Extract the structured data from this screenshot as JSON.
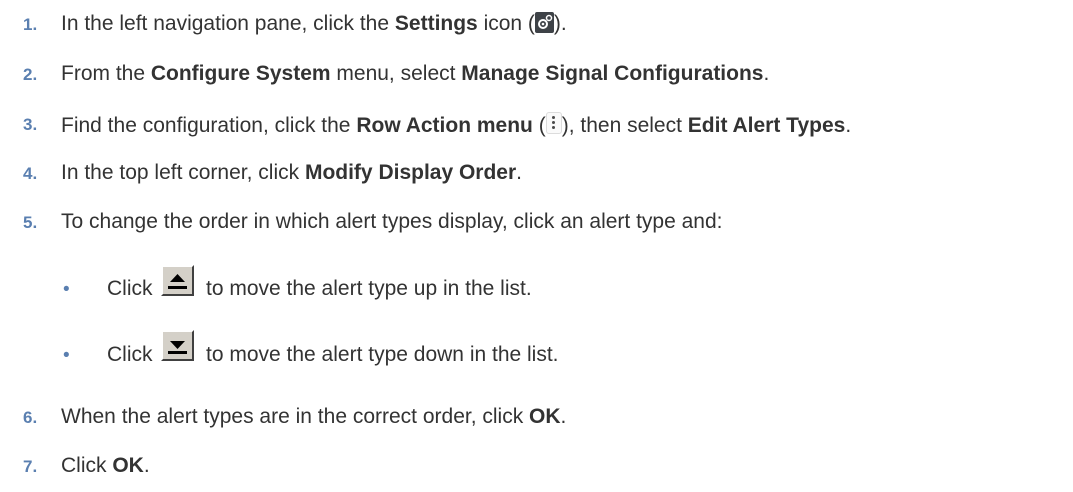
{
  "steps": [
    {
      "num": "1.",
      "pre": "In the left navigation pane, click the ",
      "b1": "Settings",
      "post": " icon (",
      "end": ")."
    },
    {
      "num": "2.",
      "pre": "From the ",
      "b1": "Configure System",
      "mid": " menu, select ",
      "b2": "Manage Signal Configurations",
      "end": "."
    },
    {
      "num": "3.",
      "pre": "Find the configuration, click the ",
      "b1": "Row Action menu",
      "mid": " (",
      "mid2": "), then select ",
      "b2": "Edit Alert Types",
      "end": "."
    },
    {
      "num": "4.",
      "pre": "In the top left corner, click ",
      "b1": "Modify Display Order",
      "end": "."
    },
    {
      "num": "5.",
      "pre": "To change the order in which alert types display, click an alert type and:"
    },
    {
      "num": "6.",
      "pre": "When the alert types are in the correct order, click ",
      "b1": "OK",
      "end": "."
    },
    {
      "num": "7.",
      "pre": "Click ",
      "b1": "OK",
      "end": "."
    }
  ],
  "substeps": [
    {
      "bullet": "•",
      "pre": "Click",
      "post": "to move the alert type up in the list.",
      "icon": "move-up-arrow-icon"
    },
    {
      "bullet": "•",
      "pre": "Click",
      "post": "to move the alert type down in the list.",
      "icon": "move-down-arrow-icon"
    }
  ],
  "icons": {
    "settings": "settings-gear-icon",
    "row_action": "vertical-ellipsis-icon"
  },
  "colors": {
    "number": "#5a7fb0",
    "text": "#333333",
    "button_face": "#d4d0c8"
  }
}
